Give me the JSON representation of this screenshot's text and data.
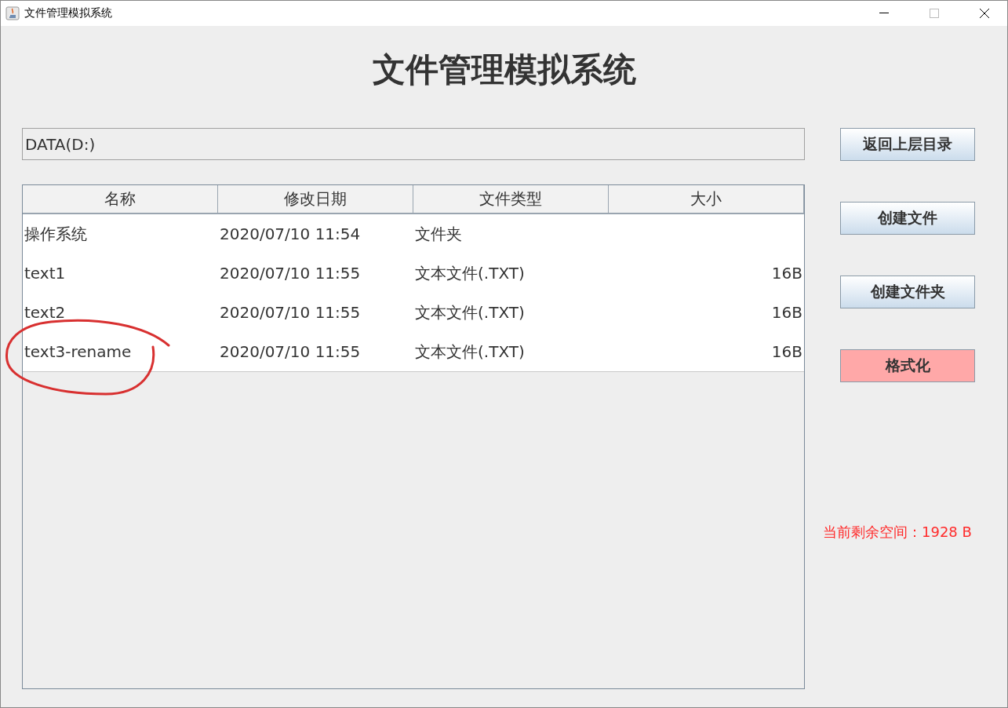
{
  "window": {
    "title": "文件管理模拟系统"
  },
  "heading": "文件管理模拟系统",
  "path_field": {
    "value": "DATA(D:)"
  },
  "table": {
    "columns": [
      "名称",
      "修改日期",
      "文件类型",
      "大小"
    ],
    "rows": [
      {
        "cells": [
          "操作系统",
          "2020/07/10 11:54",
          "文件夹",
          ""
        ],
        "circled": false
      },
      {
        "cells": [
          "text1",
          "2020/07/10 11:55",
          "文本文件(.TXT)",
          "16B"
        ],
        "circled": false
      },
      {
        "cells": [
          "text2",
          "2020/07/10 11:55",
          "文本文件(.TXT)",
          "16B"
        ],
        "circled": false
      },
      {
        "cells": [
          "text3-rename",
          "2020/07/10 11:55",
          "文本文件(.TXT)",
          "16B"
        ],
        "circled": true
      }
    ]
  },
  "buttons": [
    {
      "label": "返回上层目录",
      "kind": "normal"
    },
    {
      "label": "创建文件",
      "kind": "normal"
    },
    {
      "label": "创建文件夹",
      "kind": "normal"
    },
    {
      "label": "格式化",
      "kind": "danger"
    }
  ],
  "space_label": "当前剩余空间：1928 B"
}
